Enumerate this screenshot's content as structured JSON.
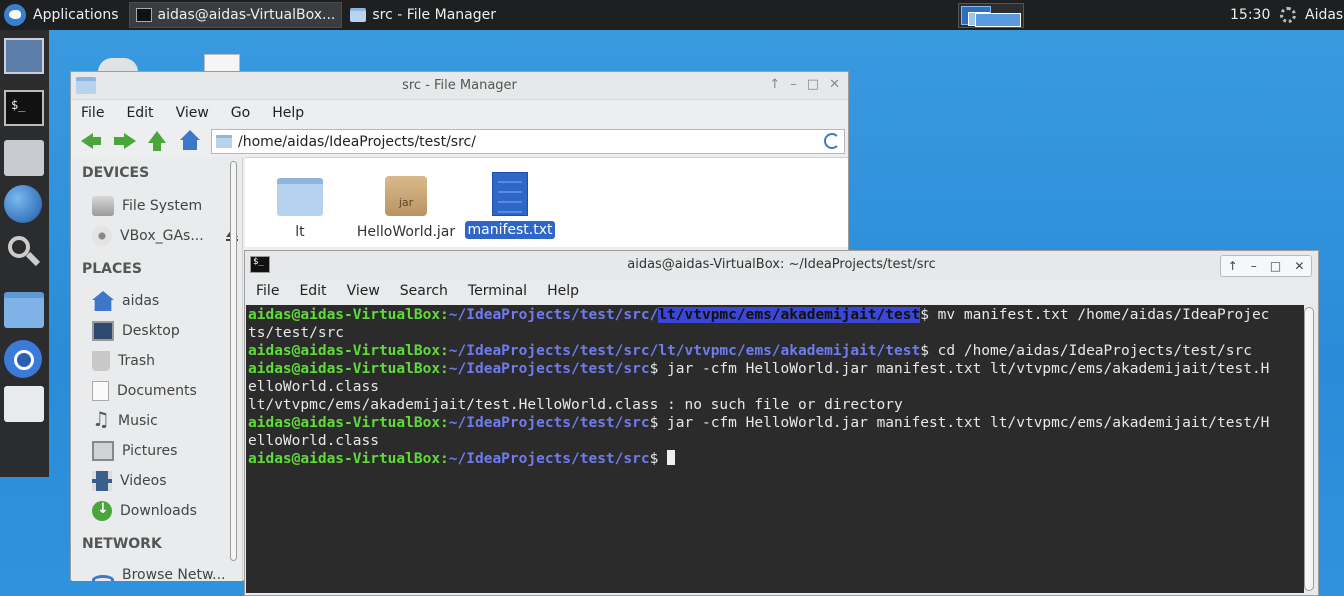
{
  "panel": {
    "applications_label": "Applications",
    "tasks": [
      {
        "label": "aidas@aidas-VirtualBox..."
      },
      {
        "label": "src - File Manager"
      }
    ],
    "clock": "15:30",
    "user": "Aidas"
  },
  "file_manager": {
    "title": "src - File Manager",
    "window_controls": [
      "↑",
      "–",
      "□",
      "✕"
    ],
    "menu": [
      "File",
      "Edit",
      "View",
      "Go",
      "Help"
    ],
    "location": "/home/aidas/IdeaProjects/test/src/",
    "sidebar": {
      "devices_header": "DEVICES",
      "devices": [
        "File System",
        "VBox_GAs..."
      ],
      "places_header": "PLACES",
      "places": [
        "aidas",
        "Desktop",
        "Trash",
        "Documents",
        "Music",
        "Pictures",
        "Videos",
        "Downloads"
      ],
      "network_header": "NETWORK",
      "network": [
        "Browse Netw..."
      ]
    },
    "files": [
      {
        "name": "lt",
        "type": "folder"
      },
      {
        "name": "HelloWorld.jar",
        "type": "jar",
        "badge": "jar"
      },
      {
        "name": "manifest.txt",
        "type": "text",
        "selected": true
      }
    ]
  },
  "terminal": {
    "title": "aidas@aidas-VirtualBox: ~/IdeaProjects/test/src",
    "window_controls": [
      "↑",
      "–",
      "□",
      "✕"
    ],
    "menu": [
      "File",
      "Edit",
      "View",
      "Search",
      "Terminal",
      "Help"
    ],
    "lines": [
      {
        "user": "aidas@aidas-VirtualBox:",
        "path": "~/IdeaProjects/test/src/",
        "highlight": "lt/vtvpmc/ems/akademijait/test",
        "cmd": "$ mv manifest.txt /home/aidas/IdeaProjec"
      },
      {
        "text": "ts/test/src"
      },
      {
        "user": "aidas@aidas-VirtualBox:",
        "path": "~/IdeaProjects/test/src/lt/vtvpmc/ems/akademijait/test",
        "cmd": "$ cd /home/aidas/IdeaProjects/test/src"
      },
      {
        "user": "aidas@aidas-VirtualBox:",
        "path": "~/IdeaProjects/test/src",
        "cmd": "$ jar -cfm HelloWorld.jar manifest.txt lt/vtvpmc/ems/akademijait/test.H"
      },
      {
        "text": "elloWorld.class"
      },
      {
        "text": "lt/vtvpmc/ems/akademijait/test.HelloWorld.class : no such file or directory"
      },
      {
        "user": "aidas@aidas-VirtualBox:",
        "path": "~/IdeaProjects/test/src",
        "cmd": "$ jar -cfm HelloWorld.jar manifest.txt lt/vtvpmc/ems/akademijait/test/H"
      },
      {
        "text": "elloWorld.class"
      },
      {
        "user": "aidas@aidas-VirtualBox:",
        "path": "~/IdeaProjects/test/src",
        "cmd": "$ "
      }
    ]
  }
}
